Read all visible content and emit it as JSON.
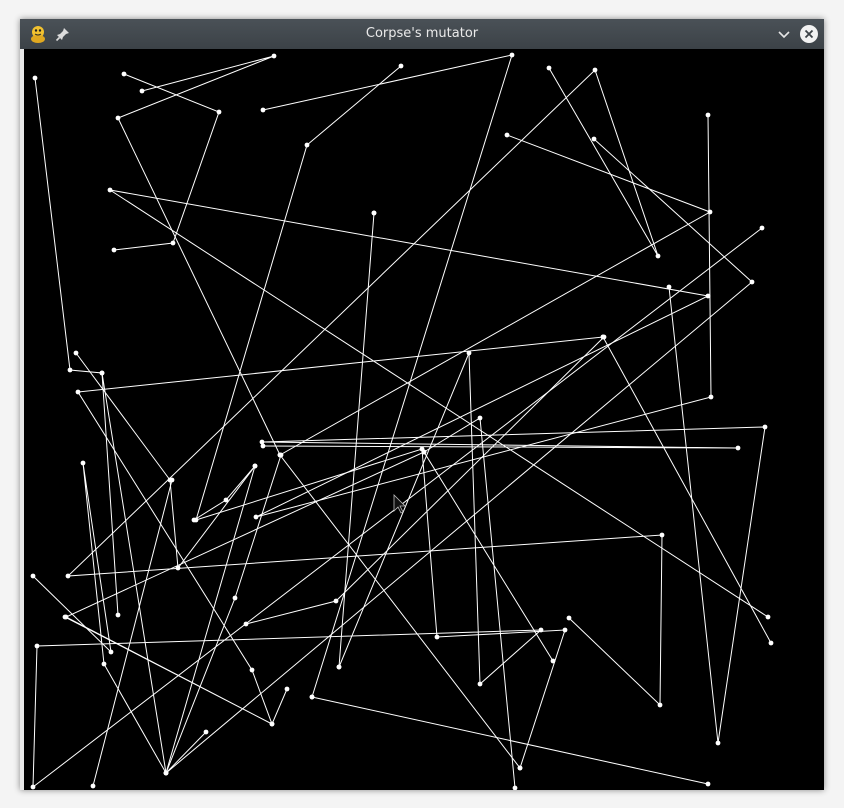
{
  "window": {
    "title": "Corpse's mutator"
  },
  "icons": {
    "app": "python-snake-icon",
    "pin": "pin-icon",
    "minimize": "chevron-down-icon",
    "close": "close-icon",
    "cursor": "mouse-pointer-icon"
  },
  "colors": {
    "titlebar": "#3f464c",
    "canvas_background": "#000000",
    "line_color": "#ffffff",
    "app_icon": "#f2c230"
  }
}
